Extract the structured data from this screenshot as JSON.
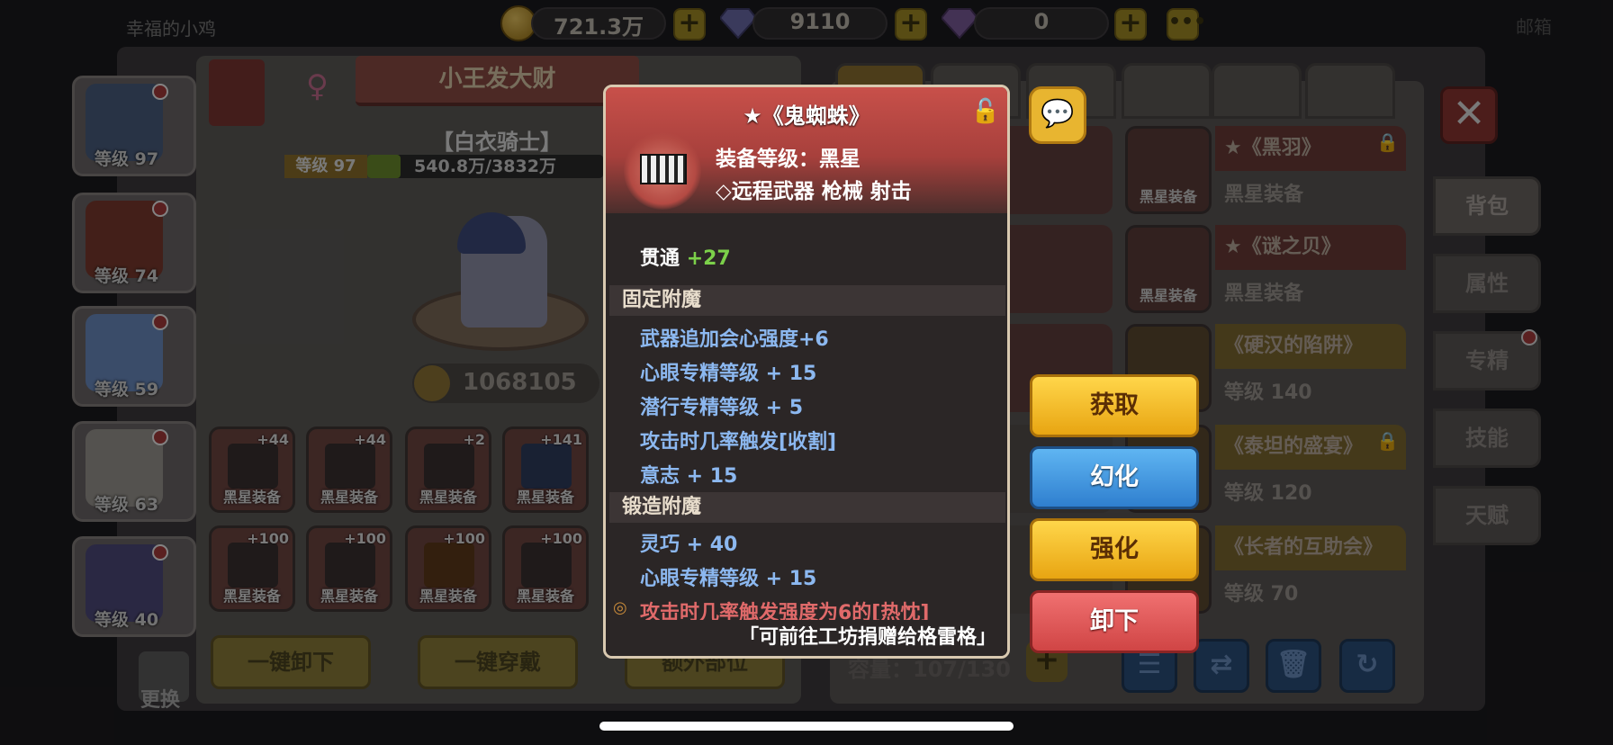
{
  "topbar": {
    "player_name": "幸福的小鸡",
    "gold": "721.3万",
    "diamond": "9110",
    "other_gem": "0",
    "more": "•••",
    "right_text": "邮箱"
  },
  "portraits": [
    {
      "level": "等级 97"
    },
    {
      "level": "等级 74"
    },
    {
      "level": "等级 59"
    },
    {
      "level": "等级 63"
    },
    {
      "level": "等级 40"
    }
  ],
  "character": {
    "name": "小王发大财",
    "class": "【白衣骑士】",
    "level": "等级 97",
    "xp_text": "540.8万/3832万",
    "xp_fraction": 0.141,
    "power": "1068105"
  },
  "equipment": [
    {
      "plus": "+44",
      "label": "黑星装备"
    },
    {
      "plus": "+44",
      "label": "黑星装备"
    },
    {
      "plus": "+2",
      "label": "黑星装备"
    },
    {
      "plus": "+141",
      "label": "黑星装备"
    },
    {
      "plus": "+100",
      "label": "黑星装备"
    },
    {
      "plus": "+100",
      "label": "黑星装备"
    },
    {
      "plus": "+100",
      "label": "黑星装备"
    },
    {
      "plus": "+100",
      "label": "黑星装备"
    }
  ],
  "bottom_buttons": {
    "unequip_all": "一键卸下",
    "equip_all": "一键穿戴",
    "extra_slot": "额外部位",
    "swap": "更换"
  },
  "inventory": {
    "items": [
      {
        "title": "★《黑羽》",
        "sub": "黑星装备",
        "icon_label": "黑星装备",
        "locked": true
      },
      {
        "title": "★《谜之贝》",
        "sub": "黑星装备",
        "icon_label": "黑星装备",
        "locked": false
      },
      {
        "title": "《硬汉的陷阱》",
        "sub": "等级 140",
        "icon_label": "",
        "locked": false
      },
      {
        "title": "《泰坦的盛宴》",
        "sub": "等级 120",
        "icon_label": "",
        "locked": true
      },
      {
        "title": "《长者的互助会》",
        "sub": "等级 70",
        "icon_label": "",
        "locked": false
      }
    ],
    "capacity": "容量：107/130",
    "side_tabs": [
      "背包",
      "属性",
      "专精",
      "技能",
      "天赋"
    ]
  },
  "popup": {
    "title": "★《鬼蜘蛛》",
    "equip_level": "装备等级：黑星",
    "type_line": "◇远程武器  枪械  射击",
    "pierce_label": "贯通",
    "pierce_value": "+27",
    "fixed_header": "固定附魔",
    "fixed_stats": [
      "武器追加会心强度+6",
      "心眼专精等级 + 15",
      "潜行专精等级 + 5",
      "攻击时几率触发[收割]",
      "意志 + 15"
    ],
    "forge_header": "锻造附魔",
    "forge_stats": [
      "灵巧 + 40",
      "心眼专精等级 + 15",
      "攻击时几率触发强度为6的[热忱]"
    ],
    "footer": "「可前往工坊捐赠给格雷格」"
  },
  "actions": {
    "obtain": "获取",
    "illusion": "幻化",
    "enhance": "强化",
    "unequip": "卸下"
  },
  "colors": {
    "gold_button": "#e8a512",
    "blue_button": "#2f7fcf",
    "red_button": "#d04545",
    "popup_header": "#c8504a",
    "stat_blue": "#8cb8f0",
    "pierce_green": "#7cd04a"
  }
}
